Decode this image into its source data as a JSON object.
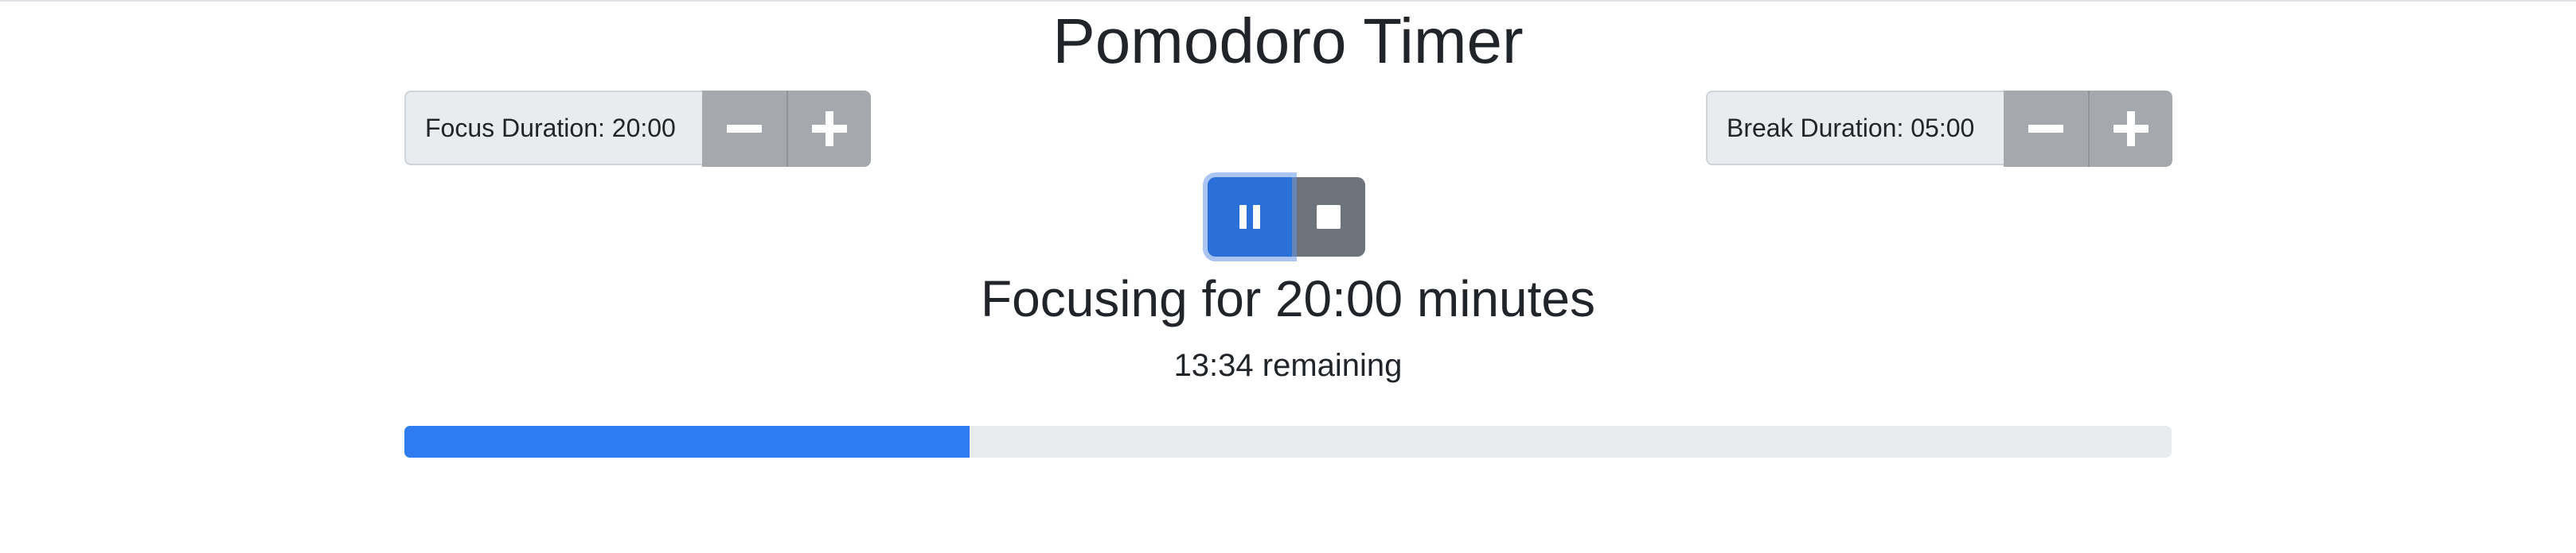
{
  "header": {
    "title": "Pomodoro Timer"
  },
  "focus": {
    "label": "Focus Duration: 20:00"
  },
  "break": {
    "label": "Break Duration: 05:00"
  },
  "controls": {
    "pause_icon": "pause-icon",
    "stop_icon": "stop-icon"
  },
  "status": {
    "heading": "Focusing for 20:00 minutes",
    "remaining": "13:34 remaining"
  },
  "progress": {
    "percent": 32
  },
  "colors": {
    "primary": "#2b6fd8",
    "progress_fill": "#2f7cf0",
    "secondary": "#6c737b",
    "stepper": "#a5a9ad"
  }
}
